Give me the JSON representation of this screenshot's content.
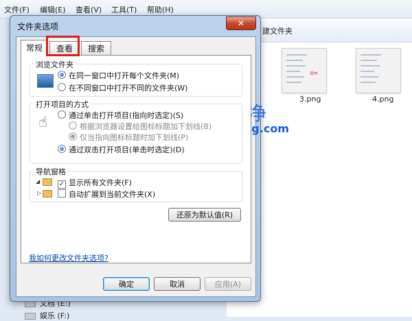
{
  "menubar": {
    "items": [
      "文件(F)",
      "编辑(E)",
      "查看(V)",
      "工具(T)",
      "帮助(H)"
    ]
  },
  "toolbar": {
    "new_folder_label": "建文件夹"
  },
  "content": {
    "thumbnails": [
      {
        "label": "3.png"
      },
      {
        "label": "4.png"
      }
    ],
    "drives": [
      "文档 (E:)",
      "娱乐 (F:)"
    ]
  },
  "watermark": {
    "name": "爱纯净",
    "url": "aichunjing.com"
  },
  "dialog": {
    "title": "文件夹选项",
    "close_label": "✕",
    "tabs": [
      {
        "label": "常规",
        "selected": true
      },
      {
        "label": "查看",
        "selected": false,
        "highlighted": true
      },
      {
        "label": "搜索",
        "selected": false
      }
    ],
    "browse_group": {
      "title": "浏览文件夹",
      "options": [
        {
          "label": "在同一窗口中打开每个文件夹(M)",
          "checked": true
        },
        {
          "label": "在不同窗口中打开不同的文件夹(W)",
          "checked": false
        }
      ]
    },
    "open_group": {
      "title": "打开项目的方式",
      "options": [
        {
          "label": "通过单击打开项目(指向时选定)(S)",
          "checked": false,
          "enabled": true
        },
        {
          "label": "根据浏览器设置给图标标题加下划线(B)",
          "checked": false,
          "enabled": false
        },
        {
          "label": "仅当指向图标标题时加下划线(P)",
          "checked": true,
          "enabled": false
        },
        {
          "label": "通过双击打开项目(单击时选定)(D)",
          "checked": true,
          "enabled": true
        }
      ]
    },
    "nav_group": {
      "title": "导航窗格",
      "options": [
        {
          "label": "显示所有文件夹(F)",
          "checked": true
        },
        {
          "label": "自动扩展到当前文件夹(X)",
          "checked": false
        }
      ]
    },
    "restore_defaults_label": "还原为默认值(R)",
    "help_link": "我如何更改文件夹选项?",
    "ok_label": "确定",
    "cancel_label": "取消",
    "apply_label": "应用(A)"
  },
  "colors": {
    "highlight_box": "#e01b1b",
    "watermark": "#2e6bd8",
    "link": "#0645ad"
  }
}
